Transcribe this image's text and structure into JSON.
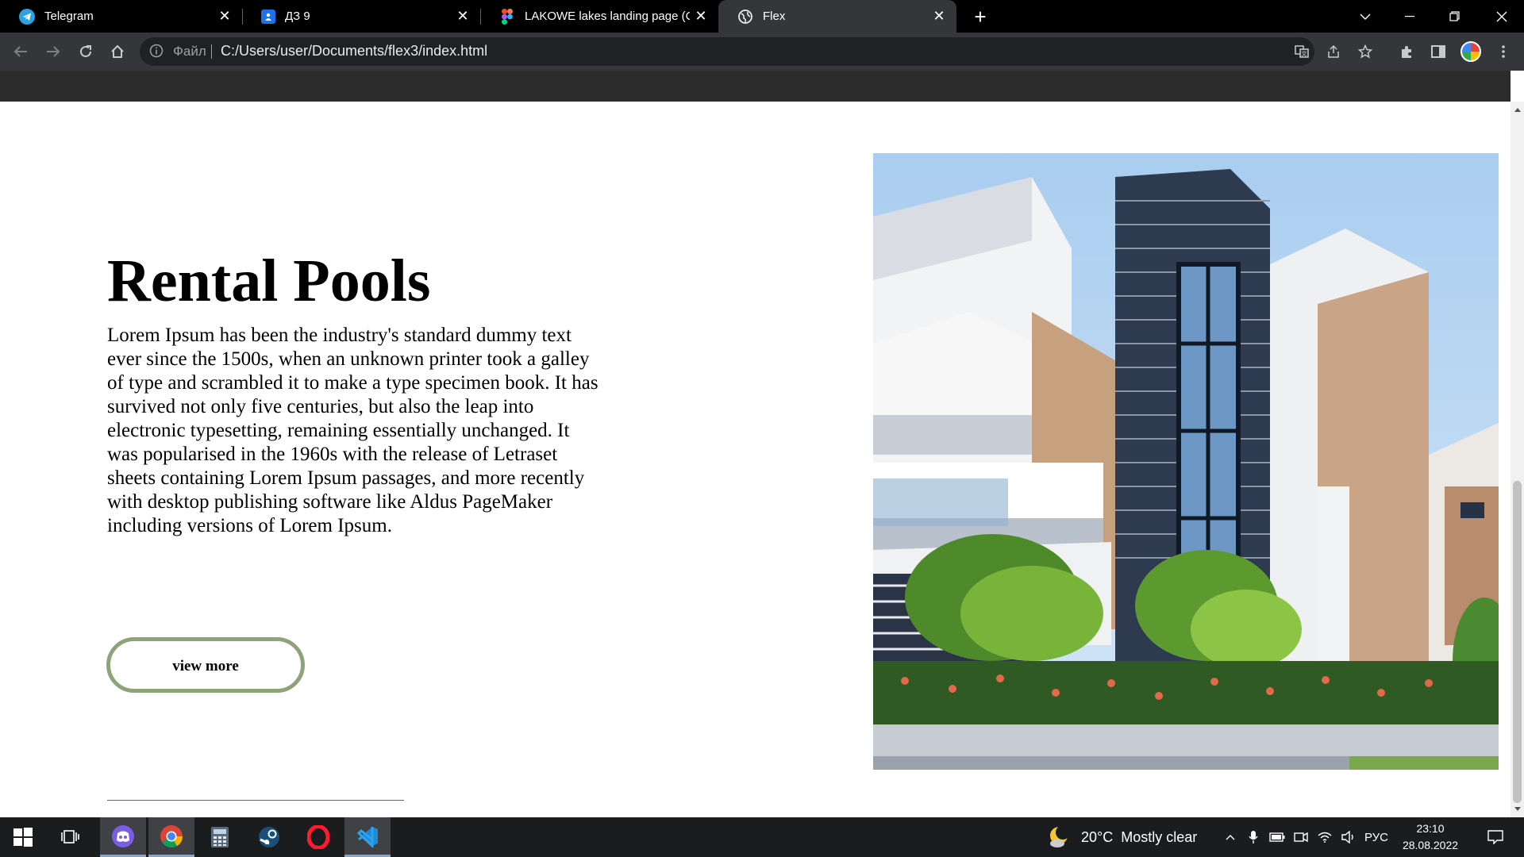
{
  "browser": {
    "tabs": [
      {
        "title": "Telegram",
        "icon": "telegram-icon",
        "active": false
      },
      {
        "title": "ДЗ 9",
        "icon": "classroom-icon",
        "active": false
      },
      {
        "title": "LAKOWE lakes landing page (Cor",
        "icon": "figma-icon",
        "active": false
      },
      {
        "title": "Flex",
        "icon": "globe-icon",
        "active": true
      }
    ],
    "address": {
      "scheme_label": "Файл",
      "url": "C:/Users/user/Documents/flex3/index.html"
    }
  },
  "page": {
    "heading": "Rental Pools",
    "paragraph": "Lorem Ipsum has been the industry's standard dummy text ever since the 1500s, when an unknown printer took a galley of type and scrambled it to make a type specimen book. It has survived not only five centuries, but also the leap into electronic typesetting, remaining essentially unchanged. It was popularised in the 1960s with the release of Letraset sheets containing Lorem Ipsum passages, and more recently with desktop publishing software like Aldus PageMaker including versions of Lorem Ipsum.",
    "button_label": "view more",
    "accent_color": "#8da37a"
  },
  "taskbar": {
    "apps": [
      "start-icon",
      "task-view-icon",
      "discord-icon",
      "chrome-icon",
      "calculator-icon",
      "steam-icon",
      "opera-icon",
      "vscode-icon"
    ],
    "weather": {
      "temp": "20°C",
      "condition": "Mostly clear"
    },
    "language": "РУС",
    "time": "23:10",
    "date": "28.08.2022"
  }
}
